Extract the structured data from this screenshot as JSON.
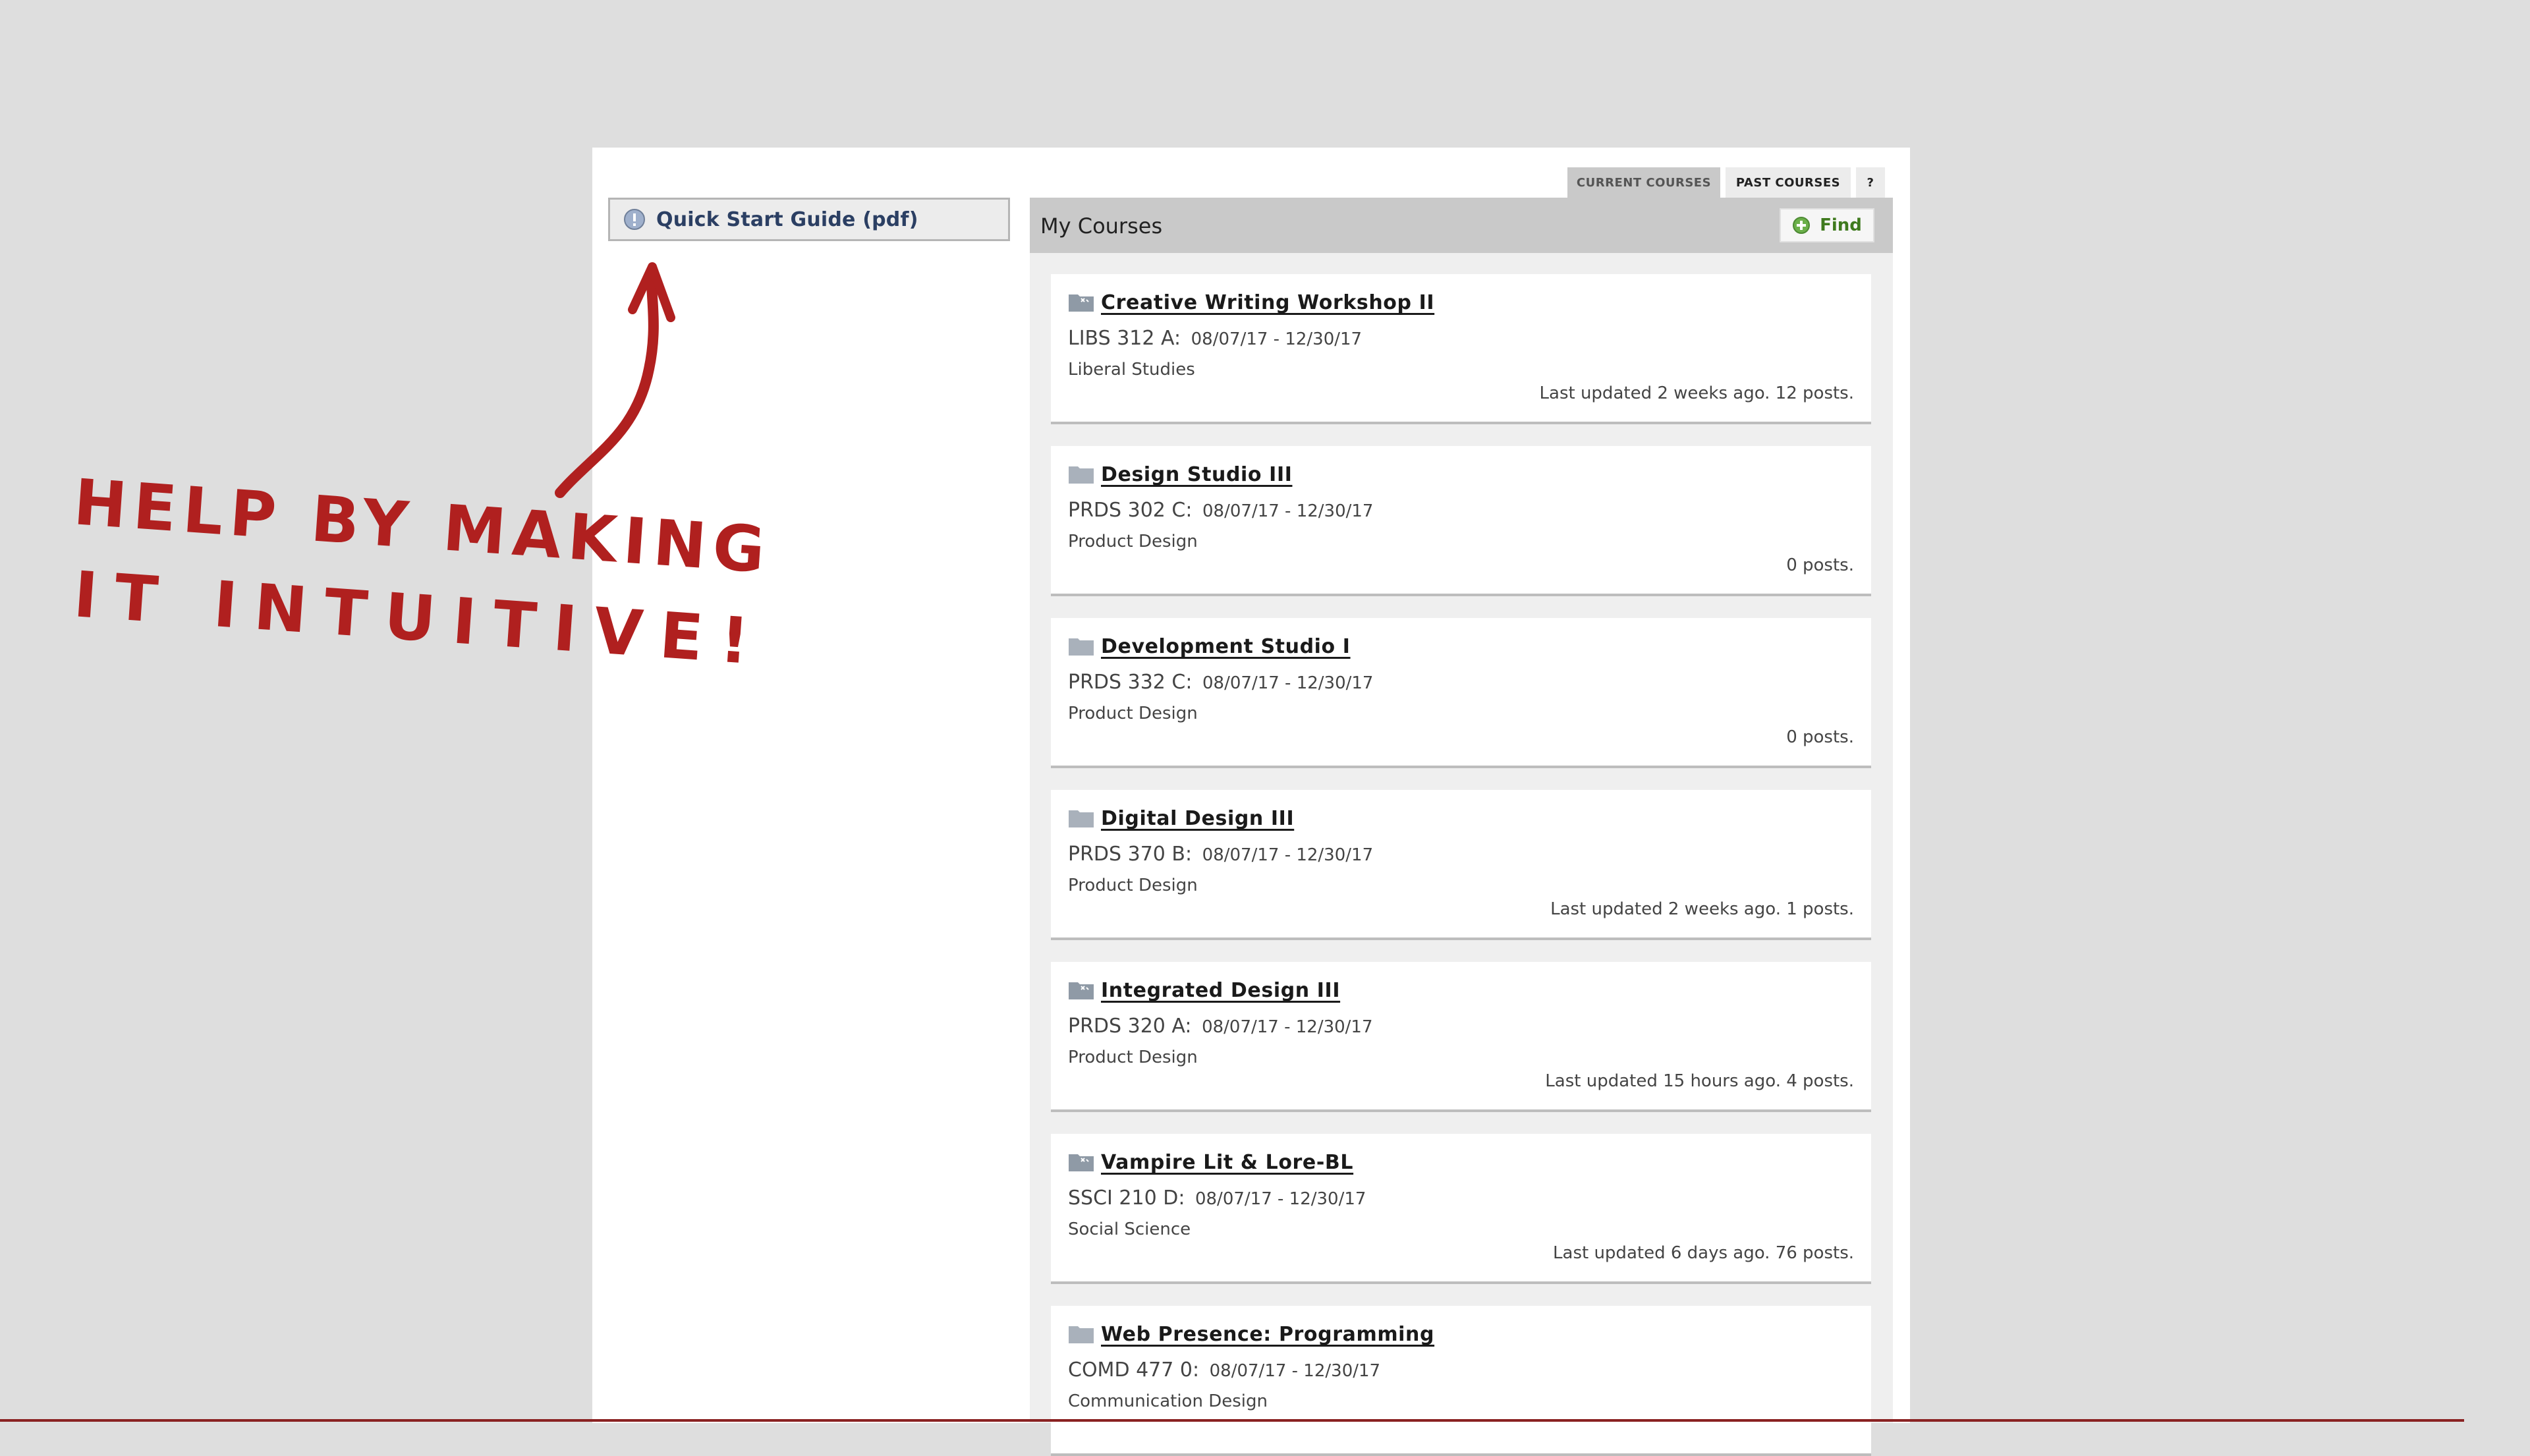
{
  "left": {
    "quick_start": {
      "label": "Quick Start Guide (pdf)",
      "icon": "info-icon"
    }
  },
  "tabs": [
    {
      "label": "CURRENT COURSES",
      "active": true
    },
    {
      "label": "PAST COURSES",
      "active": false
    },
    {
      "label": "?",
      "active": false
    }
  ],
  "courses_panel": {
    "title": "My Courses",
    "find_label": "Find",
    "find_icon": "plus-circle-icon",
    "courses": [
      {
        "name": "Creative Writing Workshop II",
        "code": "LIBS 312 A:",
        "dates": "08/07/17 - 12/30/17",
        "dept": "Liberal Studies",
        "status": "Last updated 2 weeks ago. 12 posts.",
        "icon": "folder-puzzle-icon"
      },
      {
        "name": "Design Studio III",
        "code": "PRDS 302 C:",
        "dates": "08/07/17 - 12/30/17",
        "dept": "Product Design",
        "status": "0 posts.",
        "icon": "folder-icon"
      },
      {
        "name": "Development Studio I",
        "code": "PRDS 332 C:",
        "dates": "08/07/17 - 12/30/17",
        "dept": "Product Design",
        "status": "0 posts.",
        "icon": "folder-icon"
      },
      {
        "name": "Digital Design III",
        "code": "PRDS 370 B:",
        "dates": "08/07/17 - 12/30/17",
        "dept": "Product Design",
        "status": "Last updated 2 weeks ago. 1 posts.",
        "icon": "folder-icon"
      },
      {
        "name": "Integrated Design III",
        "code": "PRDS 320 A:",
        "dates": "08/07/17 - 12/30/17",
        "dept": "Product Design",
        "status": "Last updated 15 hours ago. 4 posts.",
        "icon": "folder-puzzle-icon"
      },
      {
        "name": "Vampire Lit & Lore-BL",
        "code": "SSCI 210 D:",
        "dates": "08/07/17 - 12/30/17",
        "dept": "Social Science",
        "status": "Last updated 6 days ago. 76 posts.",
        "icon": "folder-puzzle-icon"
      },
      {
        "name": "Web Presence: Programming",
        "code": "COMD 477 0:",
        "dates": "08/07/17 - 12/30/17",
        "dept": "Communication Design",
        "status": "",
        "icon": "folder-icon"
      }
    ]
  },
  "annotation": {
    "line1": "HELP BY MAKING",
    "line2": "IT INTUITIVE!",
    "color": "#b0201f"
  },
  "colors": {
    "background": "#dedede",
    "header_gray": "#c9c9c9",
    "link_navy": "#2b3f63",
    "find_green": "#3f7a1e"
  }
}
